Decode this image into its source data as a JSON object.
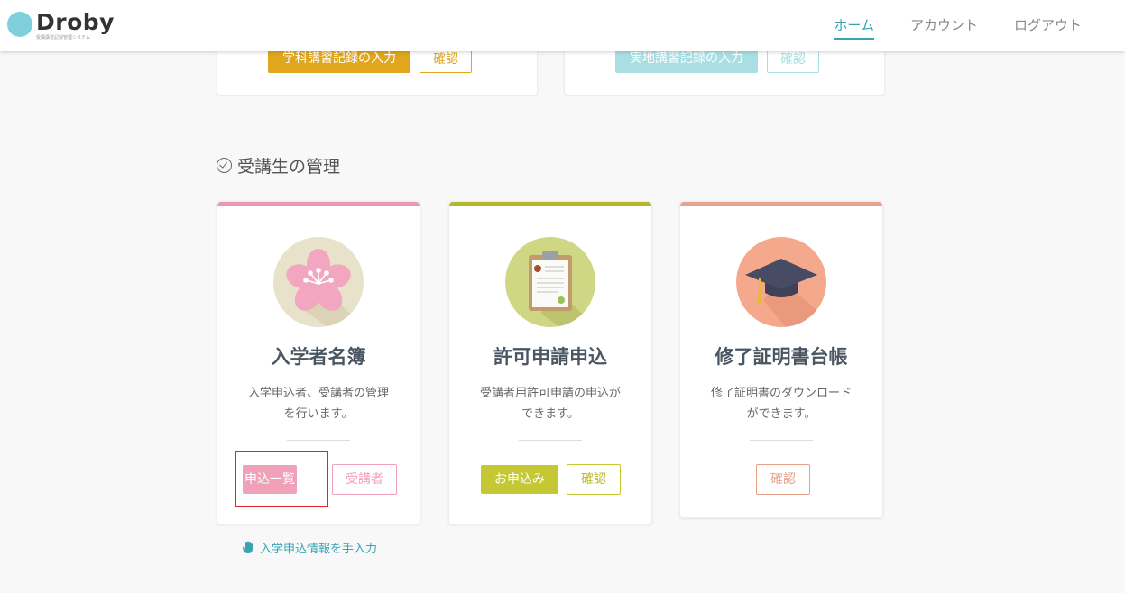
{
  "header": {
    "logo_text": "Droby",
    "logo_sub": "受講講習記録管理システム",
    "nav": [
      {
        "label": "ホーム",
        "active": true
      },
      {
        "label": "アカウント",
        "active": false
      },
      {
        "label": "ログアウト",
        "active": false
      }
    ]
  },
  "top_cards": [
    {
      "primary": "学科講習記録の入力",
      "secondary": "確認",
      "color": "#e0a61d"
    },
    {
      "primary": "実地講習記録の入力",
      "secondary": "確認",
      "color": "#a9dfe3"
    }
  ],
  "section": {
    "title": "受講生の管理",
    "icon": "check-circle-icon"
  },
  "cards": [
    {
      "title": "入学者名簿",
      "desc_line1": "入学申込者、受講者の管理",
      "desc_line2": "を行います。",
      "icon": "sakura-icon",
      "accent": "#e79ab0",
      "buttons": [
        "申込一覧",
        "受講者"
      ]
    },
    {
      "title": "許可申請申込",
      "desc_line1": "受講者用許可申請の申込が",
      "desc_line2": "できます。",
      "icon": "clipboard-icon",
      "accent": "#b6b82a",
      "buttons": [
        "お申込み",
        "確認"
      ]
    },
    {
      "title": "修了証明書台帳",
      "desc_line1": "修了証明書のダウンロード",
      "desc_line2": "ができます。",
      "icon": "graduation-cap-icon",
      "accent": "#e4a490",
      "buttons": [
        "確認"
      ]
    }
  ],
  "manual_link": {
    "label": "入学申込情報を手入力",
    "icon": "hand-pointer-icon"
  }
}
